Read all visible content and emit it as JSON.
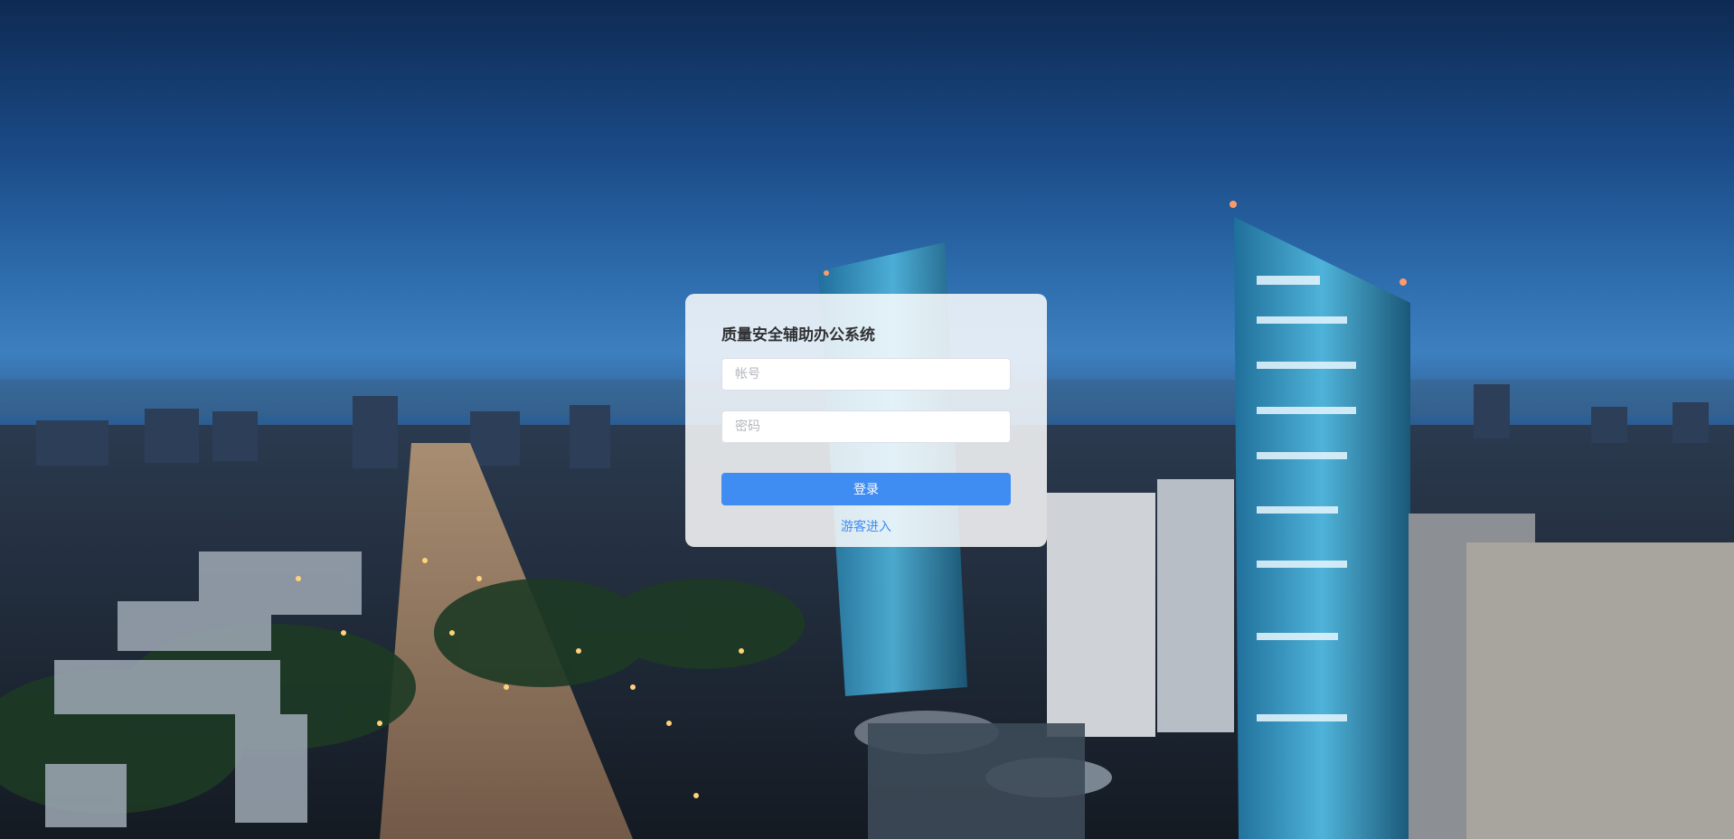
{
  "login": {
    "title": "质量安全辅助办公系统",
    "account_placeholder": "帐号",
    "password_placeholder": "密码",
    "login_label": "登录",
    "guest_label": "游客进入"
  },
  "theme": {
    "accent": "#3f8cf3",
    "card_background": "#ffffff"
  }
}
